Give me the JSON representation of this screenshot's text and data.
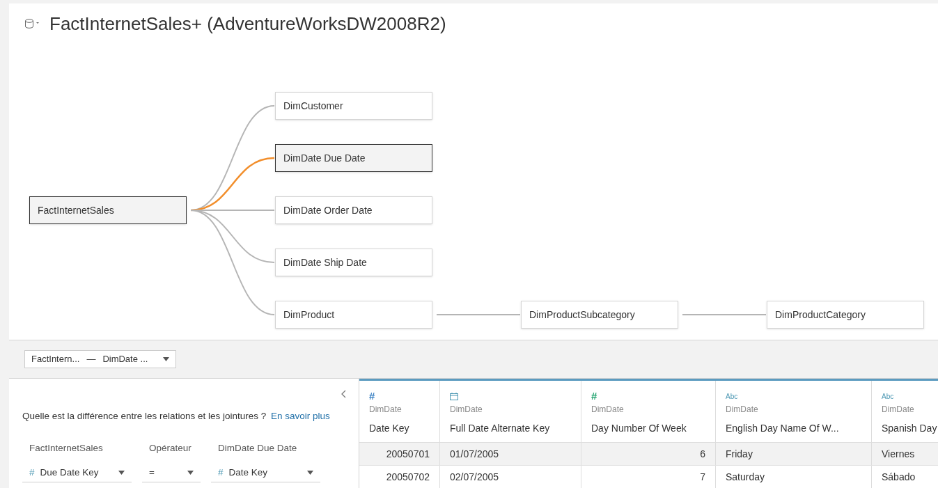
{
  "title": "FactInternetSales+ (AdventureWorksDW2008R2)",
  "tree": {
    "label": "FactInternetSales",
    "selected": true,
    "children": [
      {
        "label": "DimCustomer",
        "selected": false,
        "link_highlighted": false
      },
      {
        "label": "DimDate Due Date",
        "selected": true,
        "link_highlighted": true
      },
      {
        "label": "DimDate Order Date",
        "selected": false,
        "link_highlighted": false
      },
      {
        "label": "DimDate Ship Date",
        "selected": false,
        "link_highlighted": false
      },
      {
        "label": "DimProduct",
        "selected": false,
        "link_highlighted": false,
        "children": [
          {
            "label": "DimProductSubcategory",
            "selected": false,
            "link_highlighted": false,
            "children": [
              {
                "label": "DimProductCategory",
                "selected": false,
                "link_highlighted": false
              }
            ]
          }
        ]
      }
    ]
  },
  "relation_selector": {
    "left": "FactIntern...",
    "separator": "—",
    "right": "DimDate ..."
  },
  "join_panel": {
    "question": "Quelle est la différence entre les relations et les jointures ?",
    "link": "En savoir plus",
    "fields": [
      {
        "header": "FactInternetSales",
        "kind": "number",
        "glyph": "#",
        "value": "Due Date Key"
      },
      {
        "header": "Opérateur",
        "kind": "operator",
        "value": "="
      },
      {
        "header": "DimDate Due Date",
        "kind": "number",
        "glyph": "#",
        "value": "Date Key"
      }
    ]
  },
  "table": {
    "columns": [
      {
        "kind": "number",
        "glyph": "#",
        "continuous": false,
        "source": "DimDate",
        "name": "Date Key"
      },
      {
        "kind": "date",
        "source": "DimDate",
        "name": "Full Date Alternate Key"
      },
      {
        "kind": "number",
        "glyph": "#",
        "continuous": true,
        "source": "DimDate",
        "name": "Day Number Of Week"
      },
      {
        "kind": "string",
        "glyph": "Abc",
        "source": "DimDate",
        "name": "English Day Name Of W..."
      },
      {
        "kind": "string",
        "glyph": "Abc",
        "source": "DimDate",
        "name": "Spanish Day"
      }
    ],
    "rows": [
      {
        "selected": true,
        "cells": [
          "20050701",
          "01/07/2005",
          "6",
          "Friday",
          "Viernes"
        ]
      },
      {
        "selected": false,
        "cells": [
          "20050702",
          "02/07/2005",
          "7",
          "Saturday",
          "Sábado"
        ]
      }
    ]
  }
}
